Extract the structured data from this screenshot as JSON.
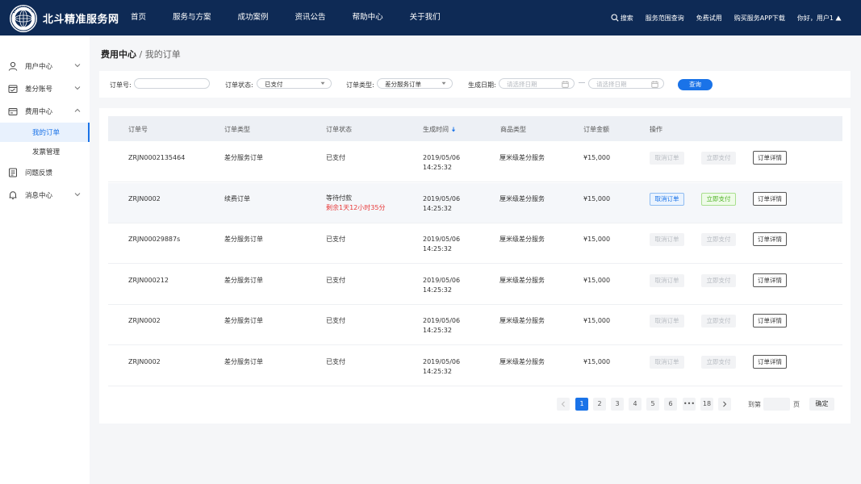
{
  "header": {
    "site_title": "北斗精准服务网",
    "nav": [
      "首页",
      "服务与方案",
      "成功案例",
      "资讯公告",
      "帮助中心",
      "关于我们"
    ],
    "search_label": "搜索",
    "service_query": "服务范围查询",
    "free_trial": "免费试用",
    "app_download": "购买服务APP下载",
    "user_greeting": "你好，用户1"
  },
  "sidebar": {
    "user_center": "用户中心",
    "diff_account": "差分账号",
    "fee_center": "费用中心",
    "my_orders": "我的订单",
    "invoice_mgmt": "发票管理",
    "feedback": "问题反馈",
    "message_center": "消息中心"
  },
  "breadcrumb": {
    "main": "费用中心",
    "sep": " / ",
    "sub": "我的订单"
  },
  "filters": {
    "order_no_label": "订单号:",
    "order_no_value": "",
    "status_label": "订单状态:",
    "status_value": "已支付",
    "type_label": "订单类型:",
    "type_value": "差分服务订单",
    "date_label": "生成日期:",
    "date_placeholder_start": "请选择日期",
    "date_placeholder_end": "请选择日期",
    "query_button": "查询"
  },
  "table": {
    "headers": [
      "订单号",
      "订单类型",
      "订单状态",
      "生成时间",
      "商品类型",
      "订单金额",
      "操作"
    ],
    "cancel_label": "取消订单",
    "pay_label": "立即支付",
    "detail_label": "订单详情",
    "rows": [
      {
        "order_no": "ZRJN0002135464",
        "type": "差分服务订单",
        "status": "已支付",
        "countdown": "",
        "date": "2019/05/06",
        "time": "14:25:32",
        "product": "厘米级差分服务",
        "amount": "¥15,000",
        "active": false
      },
      {
        "order_no": "ZRJN0002",
        "type": "续费订单",
        "status": "等待付款",
        "countdown": "剩余1天12小时35分",
        "date": "2019/05/06",
        "time": "14:25:32",
        "product": "厘米级差分服务",
        "amount": "¥15,000",
        "active": true
      },
      {
        "order_no": "ZRJN00029887s",
        "type": "差分服务订单",
        "status": "已支付",
        "countdown": "",
        "date": "2019/05/06",
        "time": "14:25:32",
        "product": "厘米级差分服务",
        "amount": "¥15,000",
        "active": false
      },
      {
        "order_no": "ZRJN000212",
        "type": "差分服务订单",
        "status": "已支付",
        "countdown": "",
        "date": "2019/05/06",
        "time": "14:25:32",
        "product": "厘米级差分服务",
        "amount": "¥15,000",
        "active": false
      },
      {
        "order_no": "ZRJN0002",
        "type": "差分服务订单",
        "status": "已支付",
        "countdown": "",
        "date": "2019/05/06",
        "time": "14:25:32",
        "product": "厘米级差分服务",
        "amount": "¥15,000",
        "active": false
      },
      {
        "order_no": "ZRJN0002",
        "type": "差分服务订单",
        "status": "已支付",
        "countdown": "",
        "date": "2019/05/06",
        "time": "14:25:32",
        "product": "厘米级差分服务",
        "amount": "¥15,000",
        "active": false
      }
    ]
  },
  "pagination": {
    "pages": [
      "1",
      "2",
      "3",
      "4",
      "5",
      "6",
      "•••",
      "18"
    ],
    "current": "1",
    "goto_label": "到第",
    "page_unit": "页",
    "confirm": "确定"
  },
  "colors": {
    "header_bg": "#0e2a55",
    "accent": "#1a73e8",
    "danger": "#e83a3a",
    "success": "#52b32a"
  }
}
